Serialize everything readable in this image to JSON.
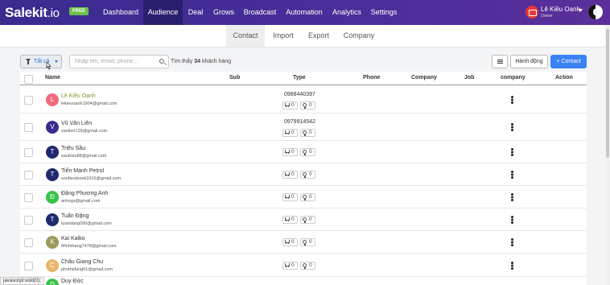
{
  "nav": {
    "logo": "Salekit",
    "logo_suffix": ".io",
    "badge": "FREE",
    "items": [
      "Dashboard",
      "Audience",
      "Deal",
      "Grows",
      "Broadcast",
      "Automation",
      "Analytics",
      "Settings"
    ],
    "active": "Audience"
  },
  "user": {
    "name": "Lê Kiều Oanh",
    "role": "Owner"
  },
  "subnav": {
    "items": [
      "Contact",
      "Import",
      "Export",
      "Company"
    ],
    "active": "Contact"
  },
  "toolbar": {
    "filter_label": "Tất cả",
    "search_placeholder": "Nhập tên, email, phone...",
    "found_prefix": "Tìm thấy",
    "found_count": "34",
    "found_suffix": "khách hàng",
    "action_label": "Hành động",
    "add_contact_label": "+ Contact"
  },
  "table": {
    "columns": [
      "Name",
      "Sub",
      "Type",
      "Phone",
      "Company",
      "Job",
      "company",
      "Action"
    ],
    "rows": [
      {
        "initial": "L",
        "name": "Lê Kiều Oanh",
        "email": "lekieuoanh1904@gmail.com",
        "phone": "0988440397",
        "cart": "0",
        "idea": "0",
        "color": "#f06a7e",
        "highlight": true
      },
      {
        "initial": "V",
        "name": "Vũ Văn Liên",
        "email": "vanlien129@gmail.com",
        "phone": "0979914542",
        "cart": "0",
        "idea": "0",
        "color": "#3d2a8f"
      },
      {
        "initial": "T",
        "name": "Triệu Sầu",
        "email": "sautrieu88@gmail.com",
        "phone": "",
        "cart": "0",
        "idea": "0",
        "color": "#1f2a6e"
      },
      {
        "initial": "T",
        "name": "Tiến Mạnh Petrol",
        "email": "sonfacebook1616@gmail.com",
        "phone": "",
        "cart": "0",
        "idea": "0",
        "color": "#1f2a6e"
      },
      {
        "initial": "Đ",
        "name": "Đặng Phương Anh",
        "email": "anhvgs@gmail.com",
        "phone": "",
        "cart": "0",
        "idea": "0",
        "color": "#38c44a"
      },
      {
        "initial": "T",
        "name": "Tuấn Đặng",
        "email": "tuandang090@gmail.com",
        "phone": "",
        "cart": "0",
        "idea": "0",
        "color": "#1f2a6e"
      },
      {
        "initial": "K",
        "name": "Kai Kaiko",
        "email": "Minhthang7478@gmail.com",
        "phone": "",
        "cart": "0",
        "idea": "0",
        "color": "#9a9a5a"
      },
      {
        "initial": "C",
        "name": "Châu Giang Chu",
        "email": "phothidung61@gmail.com",
        "phone": "",
        "cart": "0",
        "idea": "0",
        "color": "#e8b76a"
      },
      {
        "initial": "D",
        "name": "Duy Đức",
        "email": "",
        "phone": "",
        "cart": "",
        "idea": "",
        "color": "#38c44a"
      }
    ]
  },
  "status_bar": "javascript:void(0);",
  "colors": {
    "nav_bg": "#3a2b8f",
    "primary": "#3b82f6",
    "badge": "#6cc04a"
  },
  "icons": [
    "filter-icon",
    "search-icon",
    "hamburger-icon",
    "mail-icon",
    "cart-icon",
    "bulb-icon",
    "kebab-icon"
  ]
}
